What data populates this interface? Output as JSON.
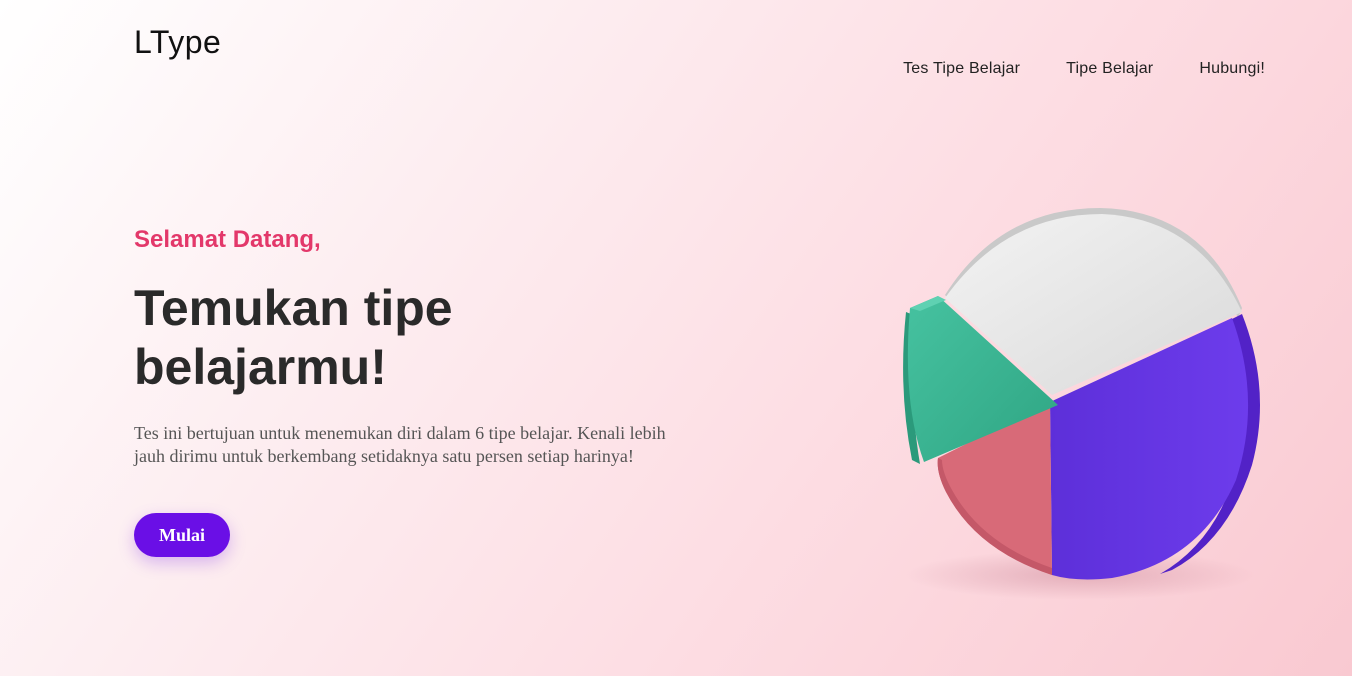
{
  "brand": {
    "logo": "LType"
  },
  "nav": {
    "items": [
      {
        "label": "Tes Tipe Belajar"
      },
      {
        "label": "Tipe Belajar"
      },
      {
        "label": "Hubungi!"
      }
    ]
  },
  "hero": {
    "greeting": "Selamat Datang,",
    "headline_line1": "Temukan tipe",
    "headline_line2": "belajarmu!",
    "description": "Tes ini bertujuan untuk menemukan diri dalam 6 tipe belajar. Kenali lebih jauh dirimu untuk berkembang setidaknya satu persen setiap harinya!",
    "cta_label": "Mulai"
  },
  "colors": {
    "accent_pink": "#e3386a",
    "button_purple": "#6a0fe6",
    "slice_gray": "#e4e4e4",
    "slice_green": "#3db594",
    "slice_red": "#d86a78",
    "slice_purple": "#6a35e4"
  },
  "illustration": {
    "icon": "pie-chart-3d-icon"
  }
}
